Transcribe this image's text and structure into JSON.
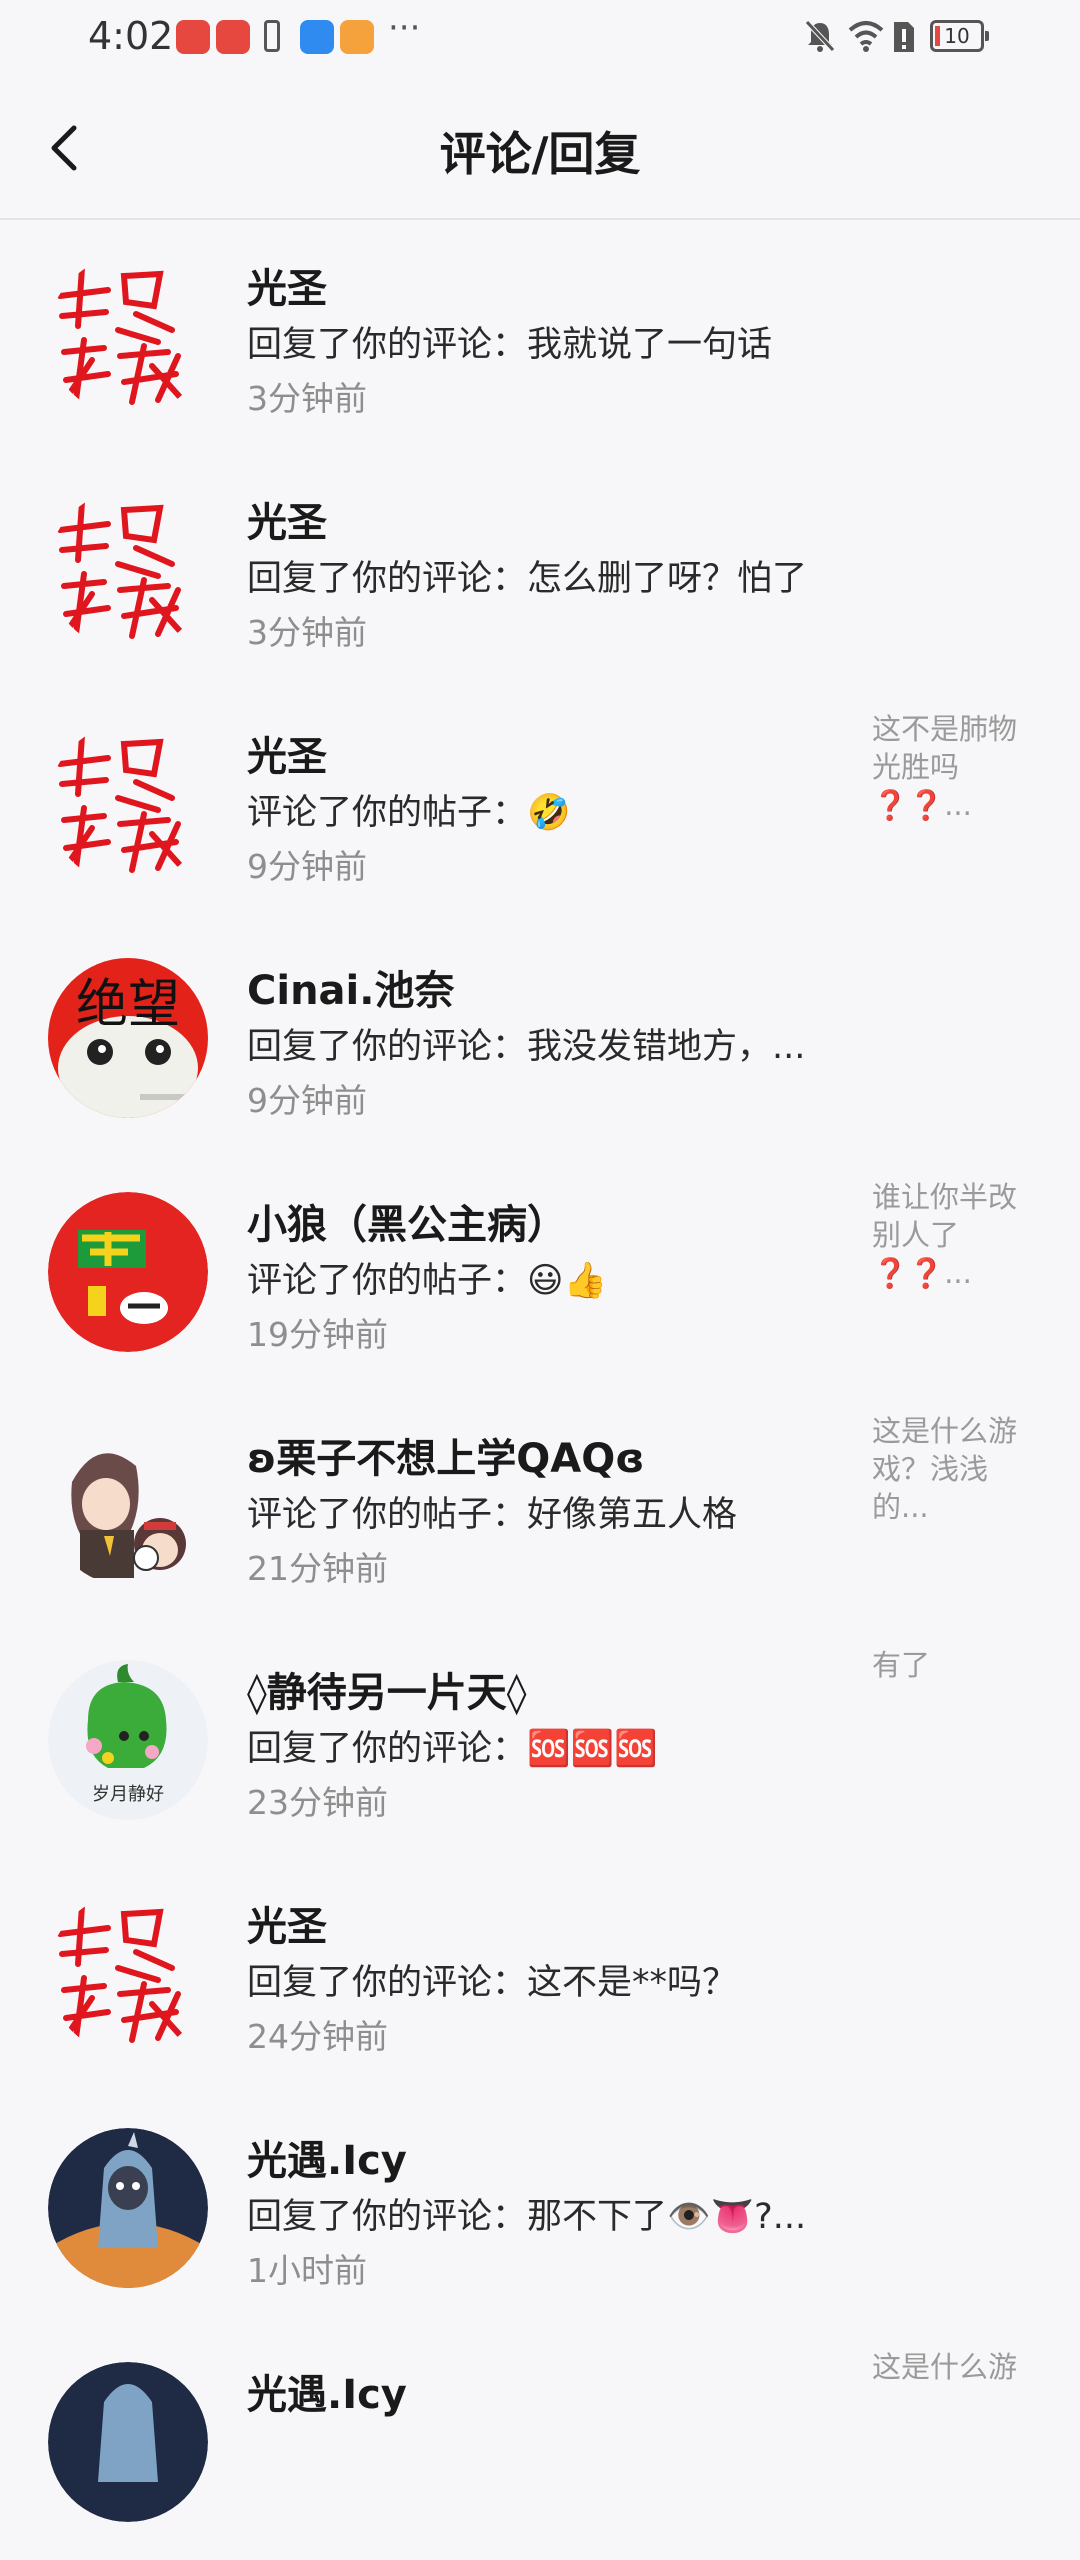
{
  "status_bar": {
    "time": "4:02",
    "dots": "···",
    "battery": "10"
  },
  "header": {
    "title": "评论/回复"
  },
  "notifications": [
    {
      "user": "光圣",
      "action": "回复了你的评论：",
      "text": "我就说了一句话",
      "time": "3分钟前",
      "preview": "",
      "avatar": "calligraphy"
    },
    {
      "user": "光圣",
      "action": "回复了你的评论：",
      "text": "怎么删了呀？怕了",
      "time": "3分钟前",
      "preview": "",
      "avatar": "calligraphy"
    },
    {
      "user": "光圣",
      "action": "评论了你的帖子：",
      "text": "🤣",
      "time": "9分钟前",
      "preview": "这不是肺物光胜吗❓❓...",
      "avatar": "calligraphy"
    },
    {
      "user": "Cinai.池奈",
      "action": "回复了你的评论：",
      "text": "我没发错地方，...",
      "time": "9分钟前",
      "preview": "",
      "avatar": "despair-meme",
      "avatar_text": "绝望"
    },
    {
      "user": "小狼（黑公主病）",
      "action": "评论了你的帖子：",
      "text": "😃👍",
      "time": "19分钟前",
      "preview": "谁让你半改别人了❓❓...",
      "avatar": "red-ball"
    },
    {
      "user": "ʚ栗子不想上学QAQɞ",
      "action": "评论了你的帖子：",
      "text": "好像第五人格",
      "time": "21分钟前",
      "preview": "这是什么游戏？浅浅的...",
      "avatar": "anime-girl"
    },
    {
      "user": "◊静待另一片天◊",
      "action": "回复了你的评论：",
      "text": "🆘🆘🆘",
      "time": "23分钟前",
      "preview": "有了",
      "avatar": "green-cartoon",
      "avatar_text": "岁月静好"
    },
    {
      "user": "光圣",
      "action": "回复了你的评论：",
      "text": "这不是**吗？",
      "time": "24分钟前",
      "preview": "",
      "avatar": "calligraphy"
    },
    {
      "user": "光遇.Icy",
      "action": "回复了你的评论：",
      "text": "那不下了👁️👅?...",
      "time": "1小时前",
      "preview": "",
      "avatar": "sky-character"
    },
    {
      "user": "光遇.Icy",
      "action": "",
      "text": "",
      "time": "",
      "preview": "这是什么游",
      "avatar": "sky-character"
    }
  ],
  "colors": {
    "background": "#f7f7f9",
    "time_gray": "#8e8e8e",
    "preview_gray": "#9a9a9a",
    "calligraphy_red": "#e0161e"
  }
}
